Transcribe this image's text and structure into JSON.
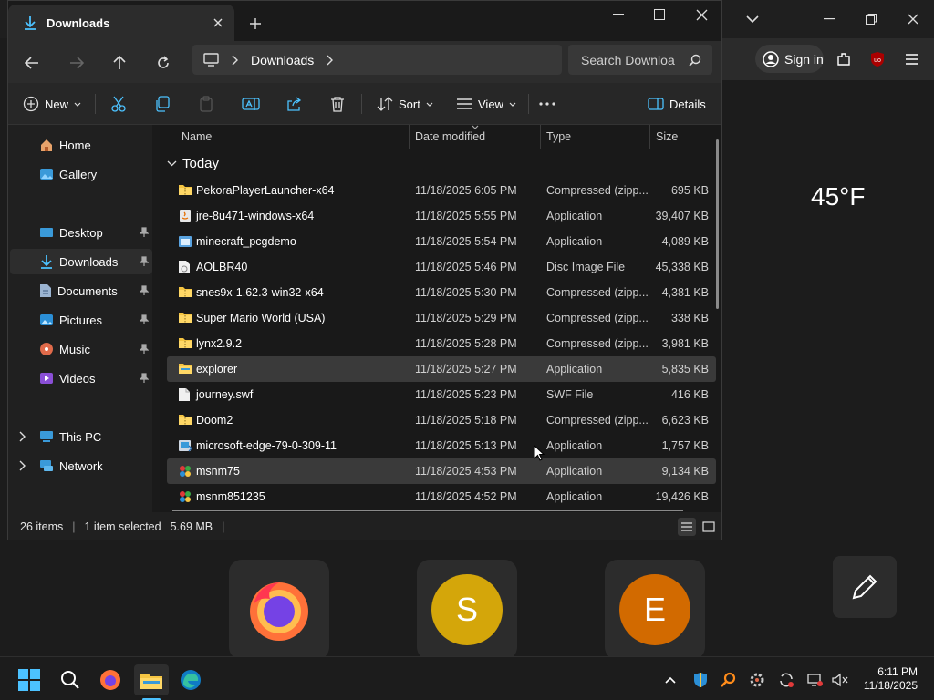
{
  "browser": {
    "sign_in_label": "Sign in",
    "weather": "45°F",
    "shortcuts": [
      {
        "name": "Firefox"
      },
      {
        "letter": "S",
        "color": "#d4a60a"
      },
      {
        "letter": "E",
        "color": "#d26a00"
      }
    ]
  },
  "window": {
    "tab_title": "Downloads",
    "breadcrumb": "Downloads",
    "search_placeholder": "Search Downloa"
  },
  "toolbar": {
    "new_label": "New",
    "sort_label": "Sort",
    "view_label": "View",
    "details_label": "Details"
  },
  "sidebar": {
    "items": [
      {
        "label": "Home",
        "icon": "home-icon"
      },
      {
        "label": "Gallery",
        "icon": "gallery-icon"
      },
      {
        "label": "Desktop",
        "icon": "desktop-icon"
      },
      {
        "label": "Downloads",
        "icon": "downloads-icon"
      },
      {
        "label": "Documents",
        "icon": "documents-icon"
      },
      {
        "label": "Pictures",
        "icon": "pictures-icon"
      },
      {
        "label": "Music",
        "icon": "music-icon"
      },
      {
        "label": "Videos",
        "icon": "videos-icon"
      },
      {
        "label": "This PC",
        "icon": "this-pc-icon"
      },
      {
        "label": "Network",
        "icon": "network-icon"
      }
    ]
  },
  "columns": {
    "name": "Name",
    "date": "Date modified",
    "type": "Type",
    "size": "Size"
  },
  "group_label": "Today",
  "files": [
    {
      "name": "PekoraPlayerLauncher-x64",
      "date": "11/18/2025 6:05 PM",
      "type": "Compressed (zipp...",
      "size": "695 KB",
      "icon": "zip-folder-icon"
    },
    {
      "name": "jre-8u471-windows-x64",
      "date": "11/18/2025 5:55 PM",
      "type": "Application",
      "size": "39,407 KB",
      "icon": "java-app-icon"
    },
    {
      "name": "minecraft_pcgdemo",
      "date": "11/18/2025 5:54 PM",
      "type": "Application",
      "size": "4,089 KB",
      "icon": "app-icon"
    },
    {
      "name": "AOLBR40",
      "date": "11/18/2025 5:46 PM",
      "type": "Disc Image File",
      "size": "45,338 KB",
      "icon": "disc-image-icon"
    },
    {
      "name": "snes9x-1.62.3-win32-x64",
      "date": "11/18/2025 5:30 PM",
      "type": "Compressed (zipp...",
      "size": "4,381 KB",
      "icon": "zip-folder-icon"
    },
    {
      "name": "Super Mario World (USA)",
      "date": "11/18/2025 5:29 PM",
      "type": "Compressed (zipp...",
      "size": "338 KB",
      "icon": "zip-folder-icon"
    },
    {
      "name": "lynx2.9.2",
      "date": "11/18/2025 5:28 PM",
      "type": "Compressed (zipp...",
      "size": "3,981 KB",
      "icon": "zip-folder-icon"
    },
    {
      "name": "explorer",
      "date": "11/18/2025 5:27 PM",
      "type": "Application",
      "size": "5,835 KB",
      "icon": "explorer-app-icon"
    },
    {
      "name": "journey.swf",
      "date": "11/18/2025 5:23 PM",
      "type": "SWF File",
      "size": "416 KB",
      "icon": "file-icon"
    },
    {
      "name": "Doom2",
      "date": "11/18/2025 5:18 PM",
      "type": "Compressed (zipp...",
      "size": "6,623 KB",
      "icon": "zip-folder-icon"
    },
    {
      "name": "microsoft-edge-79-0-309-11",
      "date": "11/18/2025 5:13 PM",
      "type": "Application",
      "size": "1,757 KB",
      "icon": "installer-icon"
    },
    {
      "name": "msnm75",
      "date": "11/18/2025 4:53 PM",
      "type": "Application",
      "size": "9,134 KB",
      "icon": "msn-app-icon"
    },
    {
      "name": "msnm851235",
      "date": "11/18/2025 4:52 PM",
      "type": "Application",
      "size": "19,426 KB",
      "icon": "msn-app-icon"
    }
  ],
  "status": {
    "items": "26 items",
    "selected": "1 item selected",
    "size": "5.69 MB"
  },
  "taskbar": {
    "time": "6:11 PM",
    "date": "11/18/2025"
  }
}
